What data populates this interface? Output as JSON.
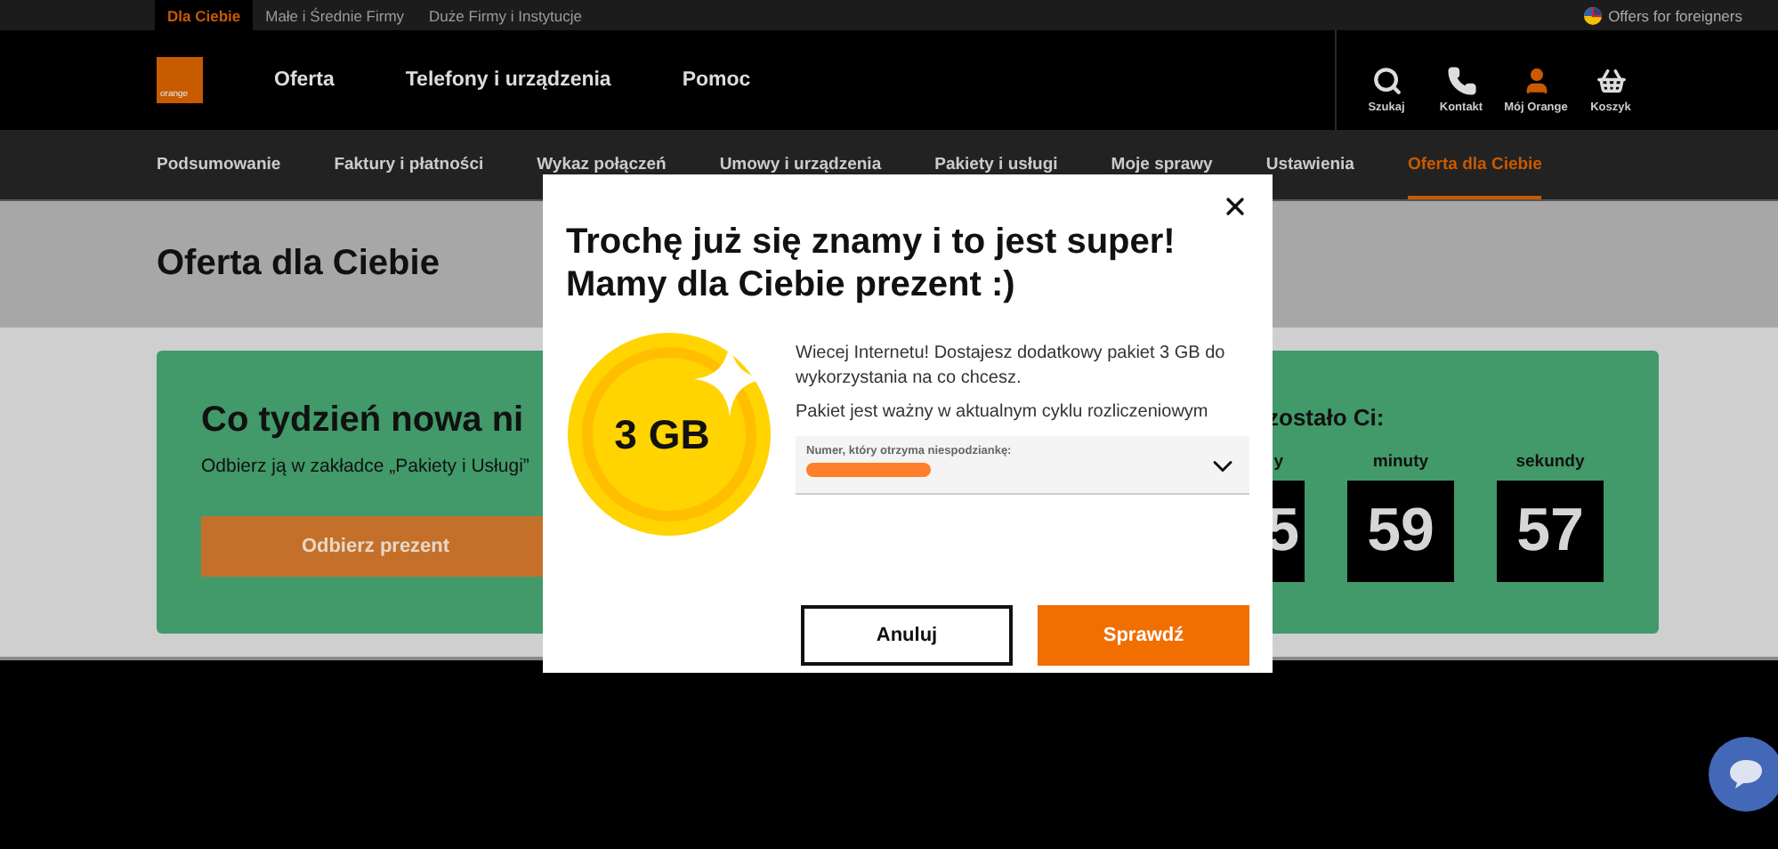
{
  "top_bar": {
    "segments": [
      {
        "label": "Dla Ciebie",
        "selected": true
      },
      {
        "label": "Małe i Średnie Firmy",
        "selected": false
      },
      {
        "label": "Duże Firmy i Instytucje",
        "selected": false
      }
    ],
    "foreigners_link": "Offers for foreigners"
  },
  "header": {
    "logo": "orange",
    "nav": [
      "Oferta",
      "Telefony i urządzenia",
      "Pomoc"
    ],
    "actions": [
      {
        "kind": "search",
        "label": "Szukaj"
      },
      {
        "kind": "phone",
        "label": "Kontakt"
      },
      {
        "kind": "account",
        "label": "Mój Orange"
      },
      {
        "kind": "basket",
        "label": "Koszyk"
      }
    ]
  },
  "subnav": [
    {
      "label": "Podsumowanie",
      "selected": false
    },
    {
      "label": "Faktury i płatności",
      "selected": false
    },
    {
      "label": "Wykaz połączeń",
      "selected": false
    },
    {
      "label": "Umowy i urządzenia",
      "selected": false
    },
    {
      "label": "Pakiety i usługi",
      "selected": false
    },
    {
      "label": "Moje sprawy",
      "selected": false
    },
    {
      "label": "Ustawienia",
      "selected": false
    },
    {
      "label": "Oferta dla Ciebie",
      "selected": true
    }
  ],
  "page_title": "Oferta dla Ciebie",
  "promo": {
    "title": "Co tydzień nowa ni",
    "subtitle": "Odbierz ją w zakładce „Pakiety i Usługi”",
    "button": "Odbierz prezent",
    "countdown": {
      "heading": "zostało Ci:",
      "units": [
        {
          "label": "y",
          "value": "5"
        },
        {
          "label": "minuty",
          "value": "59"
        },
        {
          "label": "sekundy",
          "value": "57"
        }
      ]
    }
  },
  "modal": {
    "title_lines": [
      "Trochę już się znamy i to jest super!",
      "Mamy dla Ciebie prezent :)"
    ],
    "coin_label": "3 GB",
    "description": "Wiecej Internetu! Dostajesz dodatkowy pakiet 3 GB do wykorzystania na co chcesz.",
    "validity": "Pakiet jest ważny w aktualnym cyklu rozliczeniowym",
    "select": {
      "label": "Numer, który otrzyma niespodziankę:",
      "value_redacted": true
    },
    "buttons": [
      {
        "kind": "secondary",
        "label": "Anuluj"
      },
      {
        "kind": "primary",
        "label": "Sprawdź"
      }
    ]
  }
}
